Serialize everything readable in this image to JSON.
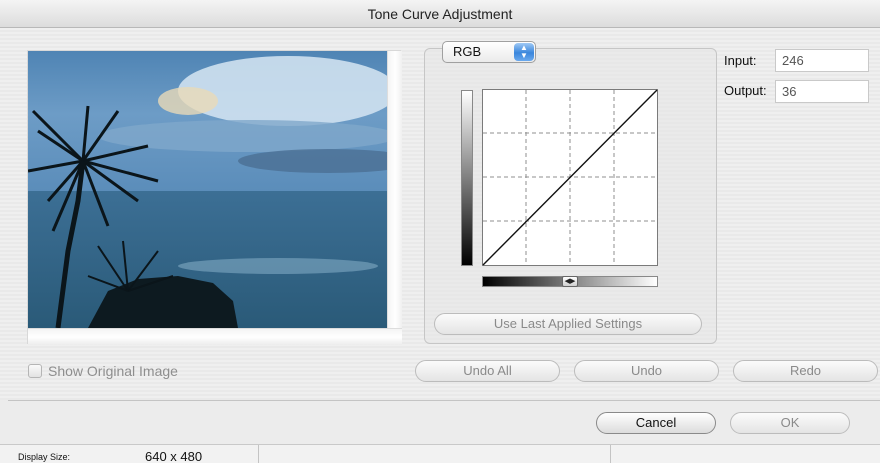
{
  "window": {
    "title": "Tone Curve Adjustment"
  },
  "preview": {
    "show_original_label": "Show Original Image",
    "show_original_checked": false
  },
  "curve": {
    "channel": "RGB",
    "use_last_label": "Use Last Applied Settings",
    "input_slider_icon": "left-right-arrows-icon"
  },
  "io": {
    "input_label": "Input:",
    "input_value": "246",
    "output_label": "Output:",
    "output_value": "36"
  },
  "actions": {
    "undo_all": "Undo All",
    "undo": "Undo",
    "redo": "Redo"
  },
  "dialog": {
    "cancel": "Cancel",
    "ok": "OK"
  },
  "status": {
    "display_size_label": "Display Size:",
    "display_size_value": "640 x 480"
  },
  "colors": {
    "accent": "#3a86dc"
  }
}
